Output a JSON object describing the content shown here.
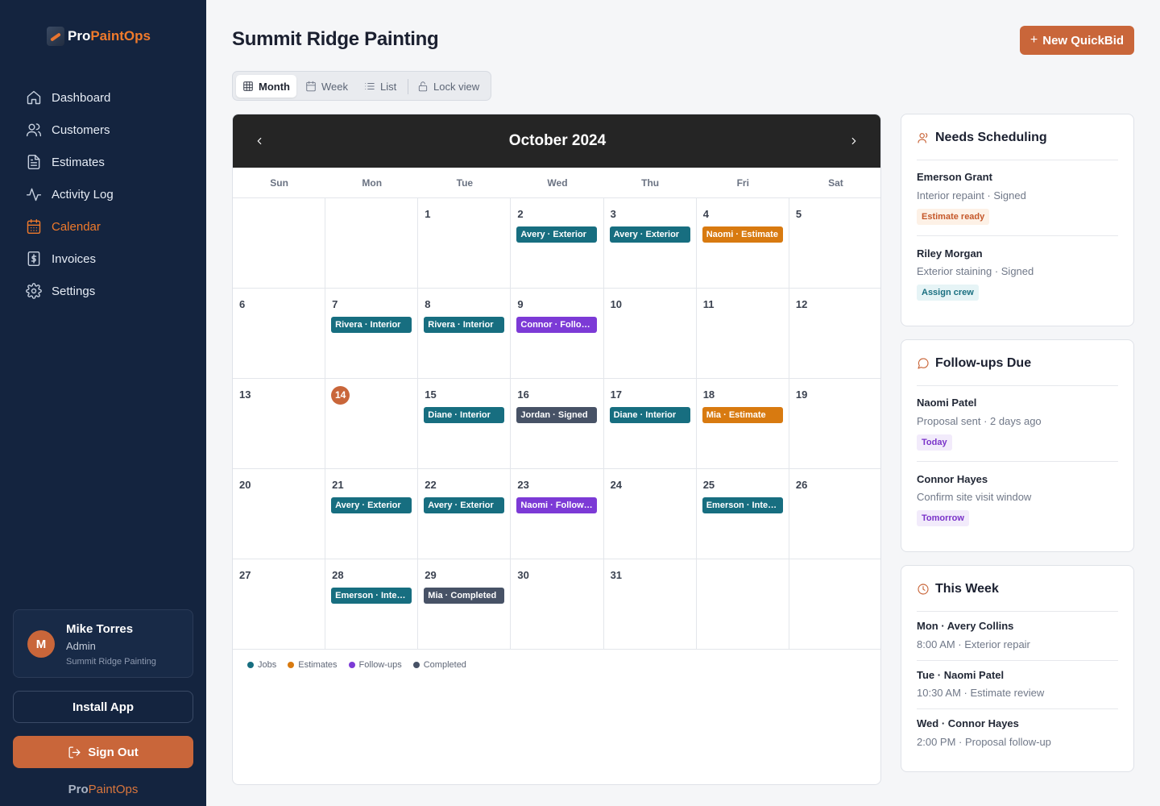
{
  "app": {
    "brand_pro": "Pro",
    "brand_ops": "PaintOps",
    "footer_pro": "Pro",
    "footer_ops": "PaintOps"
  },
  "nav": [
    {
      "label": "Dashboard",
      "icon": "home-icon",
      "active": false
    },
    {
      "label": "Customers",
      "icon": "users-icon",
      "active": false
    },
    {
      "label": "Estimates",
      "icon": "file-icon",
      "active": false
    },
    {
      "label": "Activity Log",
      "icon": "activity-icon",
      "active": false
    },
    {
      "label": "Calendar",
      "icon": "calendar-icon",
      "active": true
    },
    {
      "label": "Invoices",
      "icon": "dollar-icon",
      "active": false
    },
    {
      "label": "Settings",
      "icon": "gear-icon",
      "active": false
    }
  ],
  "user": {
    "initial": "M",
    "name": "Mike Torres",
    "role": "Admin",
    "company": "Summit Ridge Painting"
  },
  "buttons": {
    "install": "Install App",
    "signout": "Sign Out",
    "quickbid": "New QuickBid",
    "quickbid_plus": "+"
  },
  "page": {
    "title": "Summit Ridge Painting"
  },
  "view_switch": [
    {
      "label": "Month",
      "icon": "grid-icon",
      "active": true
    },
    {
      "label": "Week",
      "icon": "calendar-small-icon",
      "active": false
    },
    {
      "label": "List",
      "icon": "list-icon",
      "active": false
    },
    {
      "label": "Lock view",
      "icon": "lock-icon",
      "active": false
    }
  ],
  "calendar": {
    "month_label": "October 2024",
    "weekdays": [
      "Sun",
      "Mon",
      "Tue",
      "Wed",
      "Thu",
      "Fri",
      "Sat"
    ],
    "today": "14",
    "cells": [
      {
        "day": "",
        "events": []
      },
      {
        "day": "",
        "events": []
      },
      {
        "day": "1",
        "events": []
      },
      {
        "day": "2",
        "events": [
          {
            "label": "Avery · Exterior",
            "kind": "job"
          }
        ]
      },
      {
        "day": "3",
        "events": [
          {
            "label": "Avery · Exterior",
            "kind": "job"
          }
        ]
      },
      {
        "day": "4",
        "events": [
          {
            "label": "Naomi · Estimate",
            "kind": "estimate"
          }
        ]
      },
      {
        "day": "5",
        "events": []
      },
      {
        "day": "6",
        "events": []
      },
      {
        "day": "7",
        "events": [
          {
            "label": "Rivera · Interior",
            "kind": "job"
          }
        ]
      },
      {
        "day": "8",
        "events": [
          {
            "label": "Rivera · Interior",
            "kind": "job"
          }
        ]
      },
      {
        "day": "9",
        "events": [
          {
            "label": "Connor · Follow…",
            "kind": "followup"
          }
        ]
      },
      {
        "day": "10",
        "events": []
      },
      {
        "day": "11",
        "events": []
      },
      {
        "day": "12",
        "events": []
      },
      {
        "day": "13",
        "events": []
      },
      {
        "day": "14",
        "events": []
      },
      {
        "day": "15",
        "events": [
          {
            "label": "Diane · Interior",
            "kind": "job"
          }
        ]
      },
      {
        "day": "16",
        "events": [
          {
            "label": "Jordan · Signed",
            "kind": "completed"
          }
        ]
      },
      {
        "day": "17",
        "events": [
          {
            "label": "Diane · Interior",
            "kind": "job"
          }
        ]
      },
      {
        "day": "18",
        "events": [
          {
            "label": "Mia · Estimate",
            "kind": "estimate"
          }
        ]
      },
      {
        "day": "19",
        "events": []
      },
      {
        "day": "20",
        "events": []
      },
      {
        "day": "21",
        "events": [
          {
            "label": "Avery · Exterior",
            "kind": "job"
          }
        ]
      },
      {
        "day": "22",
        "events": [
          {
            "label": "Avery · Exterior",
            "kind": "job"
          }
        ]
      },
      {
        "day": "23",
        "events": [
          {
            "label": "Naomi · Follow-up",
            "kind": "followup"
          }
        ]
      },
      {
        "day": "24",
        "events": []
      },
      {
        "day": "25",
        "events": [
          {
            "label": "Emerson · Interior",
            "kind": "job"
          }
        ]
      },
      {
        "day": "26",
        "events": []
      },
      {
        "day": "27",
        "events": []
      },
      {
        "day": "28",
        "events": [
          {
            "label": "Emerson · Interior",
            "kind": "job"
          }
        ]
      },
      {
        "day": "29",
        "events": [
          {
            "label": "Mia · Completed",
            "kind": "completed"
          }
        ]
      },
      {
        "day": "30",
        "events": []
      },
      {
        "day": "31",
        "events": []
      },
      {
        "day": "",
        "events": []
      },
      {
        "day": "",
        "events": []
      }
    ],
    "legend": [
      {
        "label": "Jobs",
        "kind": "job"
      },
      {
        "label": "Estimates",
        "kind": "estimate"
      },
      {
        "label": "Follow-ups",
        "kind": "followup"
      },
      {
        "label": "Completed",
        "kind": "completed"
      }
    ],
    "colors": {
      "job": "#176e80",
      "estimate": "#d87a10",
      "followup": "#7c3ad6",
      "completed": "#475266"
    }
  },
  "needs_scheduling": {
    "title": "Needs Scheduling",
    "items": [
      {
        "name": "Emerson Grant",
        "detail": "Interior repaint · Signed",
        "badge": "Estimate ready"
      },
      {
        "name": "Riley Morgan",
        "detail": "Exterior staining · Signed",
        "badge": "Assign crew"
      }
    ]
  },
  "followups": {
    "title": "Follow-ups Due",
    "items": [
      {
        "name": "Naomi Patel",
        "detail": "Proposal sent · 2 days ago",
        "badge": "Today"
      },
      {
        "name": "Connor Hayes",
        "detail": "Confirm site visit window",
        "badge": "Tomorrow"
      }
    ]
  },
  "this_week": {
    "title": "This Week",
    "items": [
      {
        "name": "Mon · Avery Collins",
        "detail": "8:00 AM · Exterior repair"
      },
      {
        "name": "Tue · Naomi Patel",
        "detail": "10:30 AM · Estimate review"
      },
      {
        "name": "Wed · Connor Hayes",
        "detail": "2:00 PM · Proposal follow-up"
      }
    ]
  }
}
